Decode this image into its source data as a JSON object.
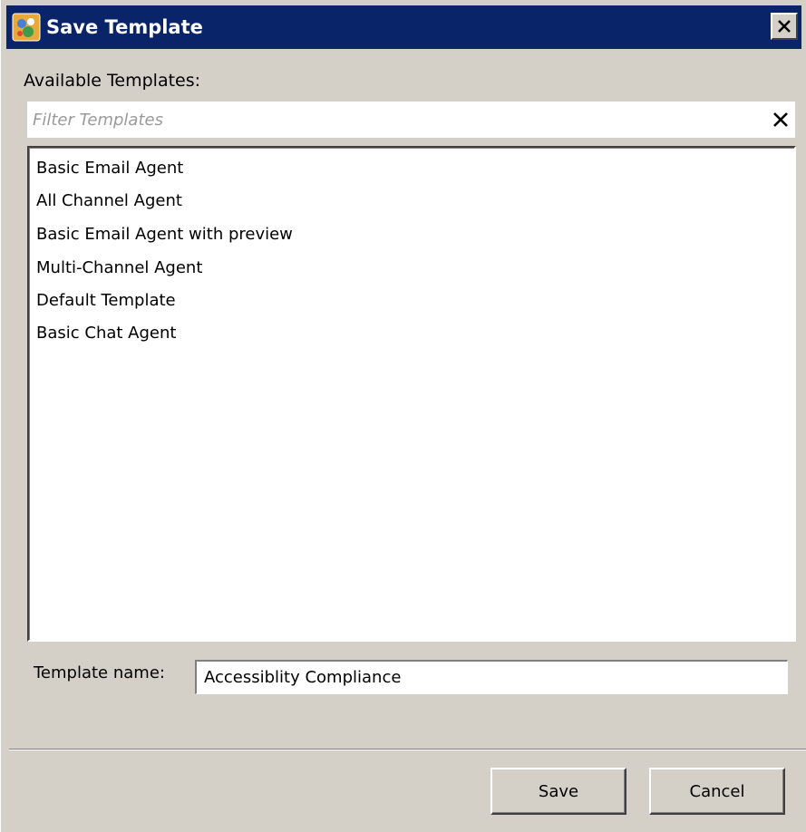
{
  "window": {
    "title": "Save Template"
  },
  "available_label": "Available Templates:",
  "filter": {
    "placeholder": "Filter Templates",
    "value": "",
    "clear_icon": "close-x-icon"
  },
  "templates": [
    "Basic Email Agent",
    "All Channel Agent",
    "Basic Email Agent with preview",
    "Multi-Channel Agent",
    "Default Template",
    "Basic Chat Agent"
  ],
  "template_name": {
    "label": "Template name:",
    "value": "Accessiblity Compliance"
  },
  "buttons": {
    "save": "Save",
    "cancel": "Cancel"
  },
  "colors": {
    "titlebar": "#0a246a",
    "dialog_bg": "#d4d0c8"
  }
}
